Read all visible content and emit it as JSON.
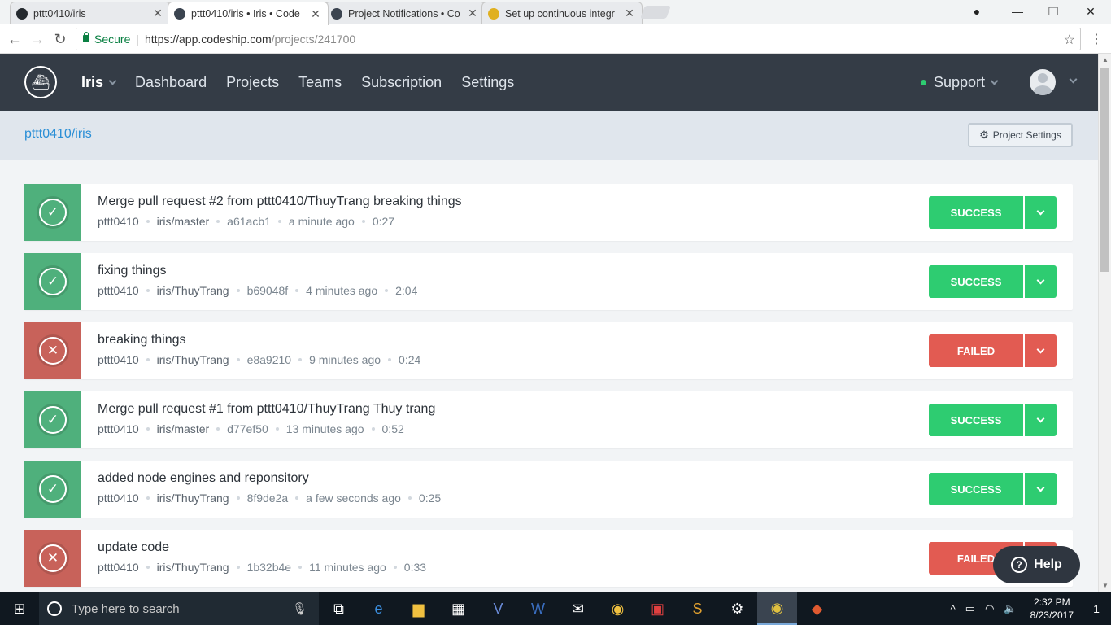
{
  "browser": {
    "tabs": [
      {
        "label": "pttt0410/iris",
        "favicon_color": "#24292e"
      },
      {
        "label": "pttt0410/iris • Iris • Code",
        "favicon_color": "#3b4450"
      },
      {
        "label": "Project Notifications • Co",
        "favicon_color": "#3b4450"
      },
      {
        "label": "Set up continuous integr",
        "favicon_color": "#e0b020"
      }
    ],
    "secure_label": "Secure",
    "url_host": "https://app.codeship.com",
    "url_path": "/projects/241700"
  },
  "app": {
    "brand": "Iris",
    "nav": [
      "Dashboard",
      "Projects",
      "Teams",
      "Subscription",
      "Settings"
    ],
    "support": "Support",
    "breadcrumb": "pttt0410/iris",
    "project_settings": "Project Settings",
    "help": "Help"
  },
  "builds": [
    {
      "status": "ok",
      "title": "Merge pull request #2 from pttt0410/ThuyTrang breaking things",
      "author": "pttt0410",
      "branch": "iris/master",
      "commit": "a61acb1",
      "time": "a minute ago",
      "duration": "0:27",
      "badge": "SUCCESS"
    },
    {
      "status": "ok",
      "title": "fixing things",
      "author": "pttt0410",
      "branch": "iris/ThuyTrang",
      "commit": "b69048f",
      "time": "4 minutes ago",
      "duration": "2:04",
      "badge": "SUCCESS"
    },
    {
      "status": "bad",
      "title": "breaking things",
      "author": "pttt0410",
      "branch": "iris/ThuyTrang",
      "commit": "e8a9210",
      "time": "9 minutes ago",
      "duration": "0:24",
      "badge": "FAILED"
    },
    {
      "status": "ok",
      "title": "Merge pull request #1 from pttt0410/ThuyTrang Thuy trang",
      "author": "pttt0410",
      "branch": "iris/master",
      "commit": "d77ef50",
      "time": "13 minutes ago",
      "duration": "0:52",
      "badge": "SUCCESS"
    },
    {
      "status": "ok",
      "title": "added node engines and reponsitory",
      "author": "pttt0410",
      "branch": "iris/ThuyTrang",
      "commit": "8f9de2a",
      "time": "a few seconds ago",
      "duration": "0:25",
      "badge": "SUCCESS"
    },
    {
      "status": "bad",
      "title": "update code",
      "author": "pttt0410",
      "branch": "iris/ThuyTrang",
      "commit": "1b32b4e",
      "time": "11 minutes ago",
      "duration": "0:33",
      "badge": "FAILED"
    }
  ],
  "taskbar": {
    "search_placeholder": "Type here to search",
    "time": "2:32 PM",
    "date": "8/23/2017",
    "notification_count": "1"
  },
  "colors": {
    "header_bg": "#343c46",
    "success": "#2ecc71",
    "failed": "#e25b52",
    "link": "#2b8fd6"
  }
}
